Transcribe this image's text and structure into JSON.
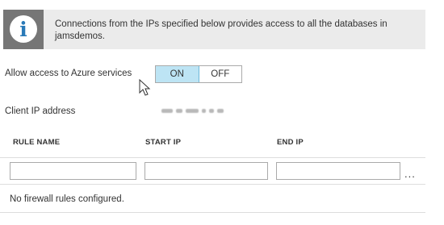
{
  "banner": {
    "icon": "info-icon",
    "glyph": "i",
    "text": "Connections from the IPs specified below provides access to all the databases in jamsdemos."
  },
  "azure_access": {
    "label": "Allow access to Azure services",
    "on_label": "ON",
    "off_label": "OFF",
    "selected": "ON"
  },
  "client_ip": {
    "label": "Client IP address",
    "value_obscured": true
  },
  "rules_table": {
    "columns": [
      "RULE NAME",
      "START IP",
      "END IP"
    ],
    "more_label": "...",
    "empty_message": "No firewall rules configured."
  },
  "colors": {
    "banner_bg": "#ebebeb",
    "icon_bg": "#767676",
    "icon_glyph": "#2a7ab8",
    "toggle_selected_bg": "#bde4f4"
  }
}
